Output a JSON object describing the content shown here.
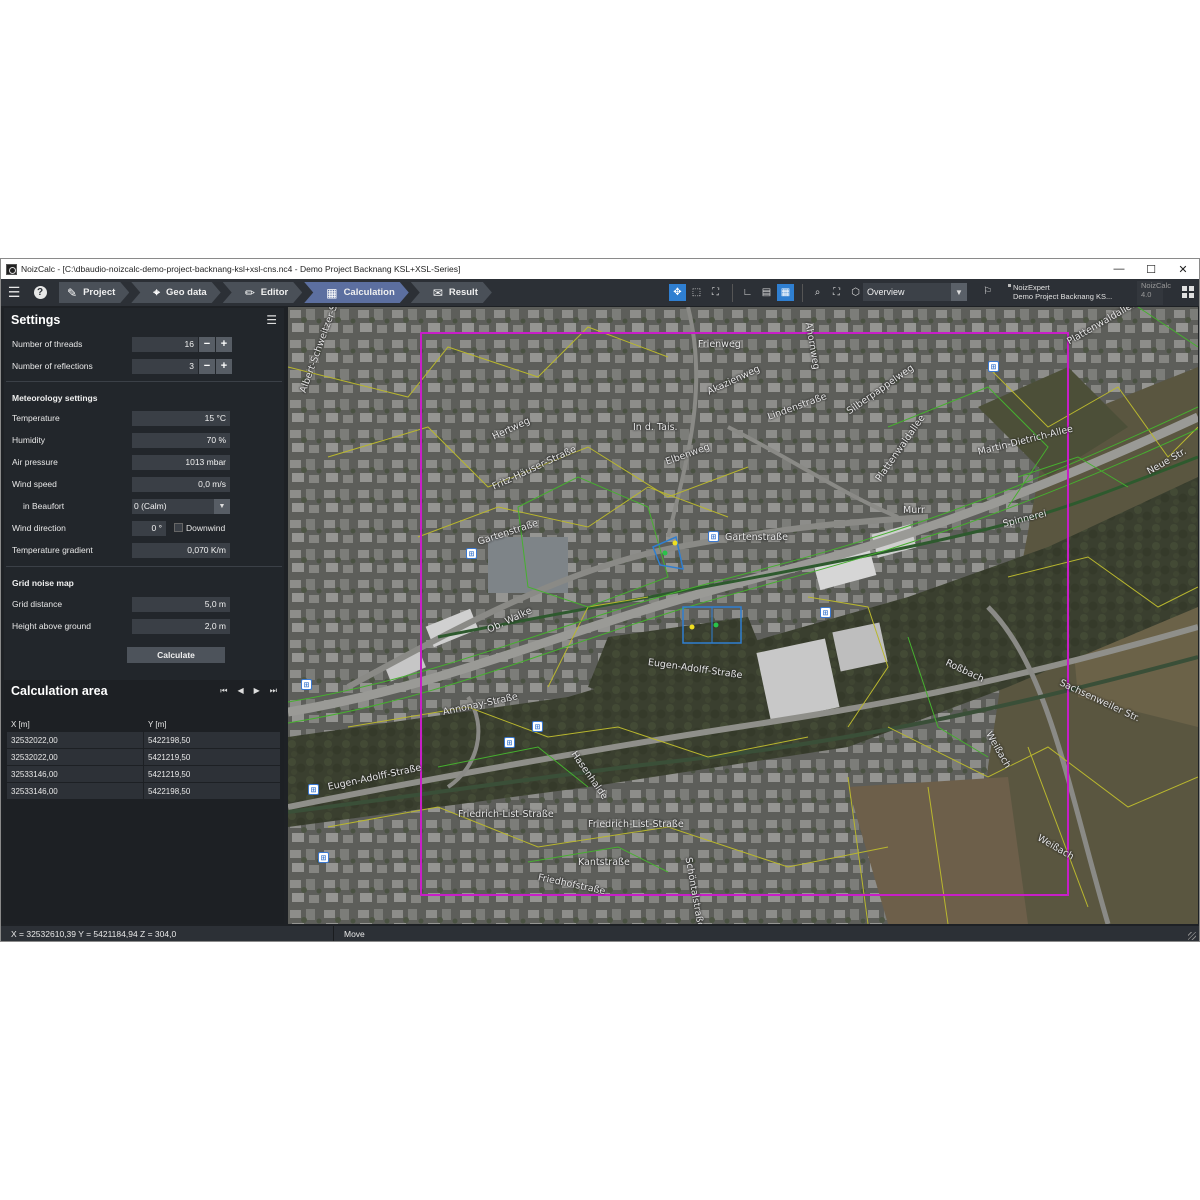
{
  "window": {
    "title": "NoizCalc - [C:\\dbaudio-noizcalc-demo-project-backnang-ksl+xsl-cns.nc4 - Demo Project Backnang KSL+XSL-Series]",
    "minimize": "—",
    "maximize": "☐",
    "close": "✕"
  },
  "toolbar": {
    "menu_icon": "menu-icon",
    "help_icon": "help-icon",
    "help_label": "?",
    "workflow": [
      {
        "label": "Project",
        "icon": "wrench-icon",
        "glyph": "🔧",
        "active": false
      },
      {
        "label": "Geo data",
        "icon": "map-pin-icon",
        "glyph": "⌖",
        "active": false
      },
      {
        "label": "Editor",
        "icon": "pencil-icon",
        "glyph": "✎",
        "active": false
      },
      {
        "label": "Calculation",
        "icon": "calculator-icon",
        "glyph": "▦",
        "active": true
      },
      {
        "label": "Result",
        "icon": "chat-check-icon",
        "glyph": "✉",
        "active": false
      }
    ],
    "view_select": "Overview",
    "project_info": {
      "line1": "NoizExpert",
      "line2": "Demo Project Backnang KS..."
    },
    "version": {
      "line1": "NoizCalc",
      "line2": "4.0"
    },
    "accent_color": "#2f7fd1"
  },
  "settings": {
    "title": "Settings",
    "threads_label": "Number of threads",
    "threads_value": "16",
    "reflections_label": "Number of reflections",
    "reflections_value": "3",
    "meteo_title": "Meteorology settings",
    "temperature_label": "Temperature",
    "temperature_value": "15 °C",
    "humidity_label": "Humidity",
    "humidity_value": "70 %",
    "air_pressure_label": "Air pressure",
    "air_pressure_value": "1013 mbar",
    "wind_speed_label": "Wind speed",
    "wind_speed_value": "0,0 m/s",
    "beaufort_label": "in Beaufort",
    "beaufort_value": "0 (Calm)",
    "wind_direction_label": "Wind direction",
    "wind_direction_value": "0 °",
    "downwind_label": "Downwind",
    "temp_gradient_label": "Temperature gradient",
    "temp_gradient_value": "0,070 K/m",
    "grid_title": "Grid noise map",
    "grid_distance_label": "Grid distance",
    "grid_distance_value": "5,0 m",
    "height_label": "Height above ground",
    "height_value": "2,0 m",
    "calculate_label": "Calculate"
  },
  "calc_area": {
    "title": "Calculation area",
    "columns": [
      "X [m]",
      "Y [m]"
    ],
    "rows": [
      [
        "32532022,00",
        "5422198,50"
      ],
      [
        "32532022,00",
        "5421219,50"
      ],
      [
        "32533146,00",
        "5421219,50"
      ],
      [
        "32533146,00",
        "5422198,50"
      ]
    ]
  },
  "map": {
    "streets": [
      "Frienweg",
      "Akazienweg",
      "In d. Tais.",
      "Hertweg",
      "Gartenstraße",
      "Gartenstraße",
      "Ob. Walke",
      "Eugen-Adolff-Straße",
      "Eugen-Adolff-Straße",
      "Friedrich-List-Straße",
      "Friedrich-List-Straße",
      "Kantstraße",
      "Friedhofstraße",
      "Martin-Dietrich-Allee",
      "Plattenwaldallee",
      "Murr",
      "Spinnerei",
      "Roßbach",
      "Sachsenweiler Str.",
      "Weißach",
      "Annonay-Straße",
      "Lindenstraße",
      "Silberpappelweg",
      "Elbenweg",
      "Fritz-Häuser-Straße",
      "Schöntalstraße",
      "Hasenhalde",
      "Ahornweg",
      "Neue Str.",
      "Plattenwaldallee",
      "Weißach",
      "Albert-Schweitzer-Str."
    ],
    "calc_area_color": "#c81ec8",
    "building_color": "#9a9a9a"
  },
  "status": {
    "coords": "X = 32532610,39   Y = 5421184,94   Z = 304,0",
    "mode": "Move"
  }
}
